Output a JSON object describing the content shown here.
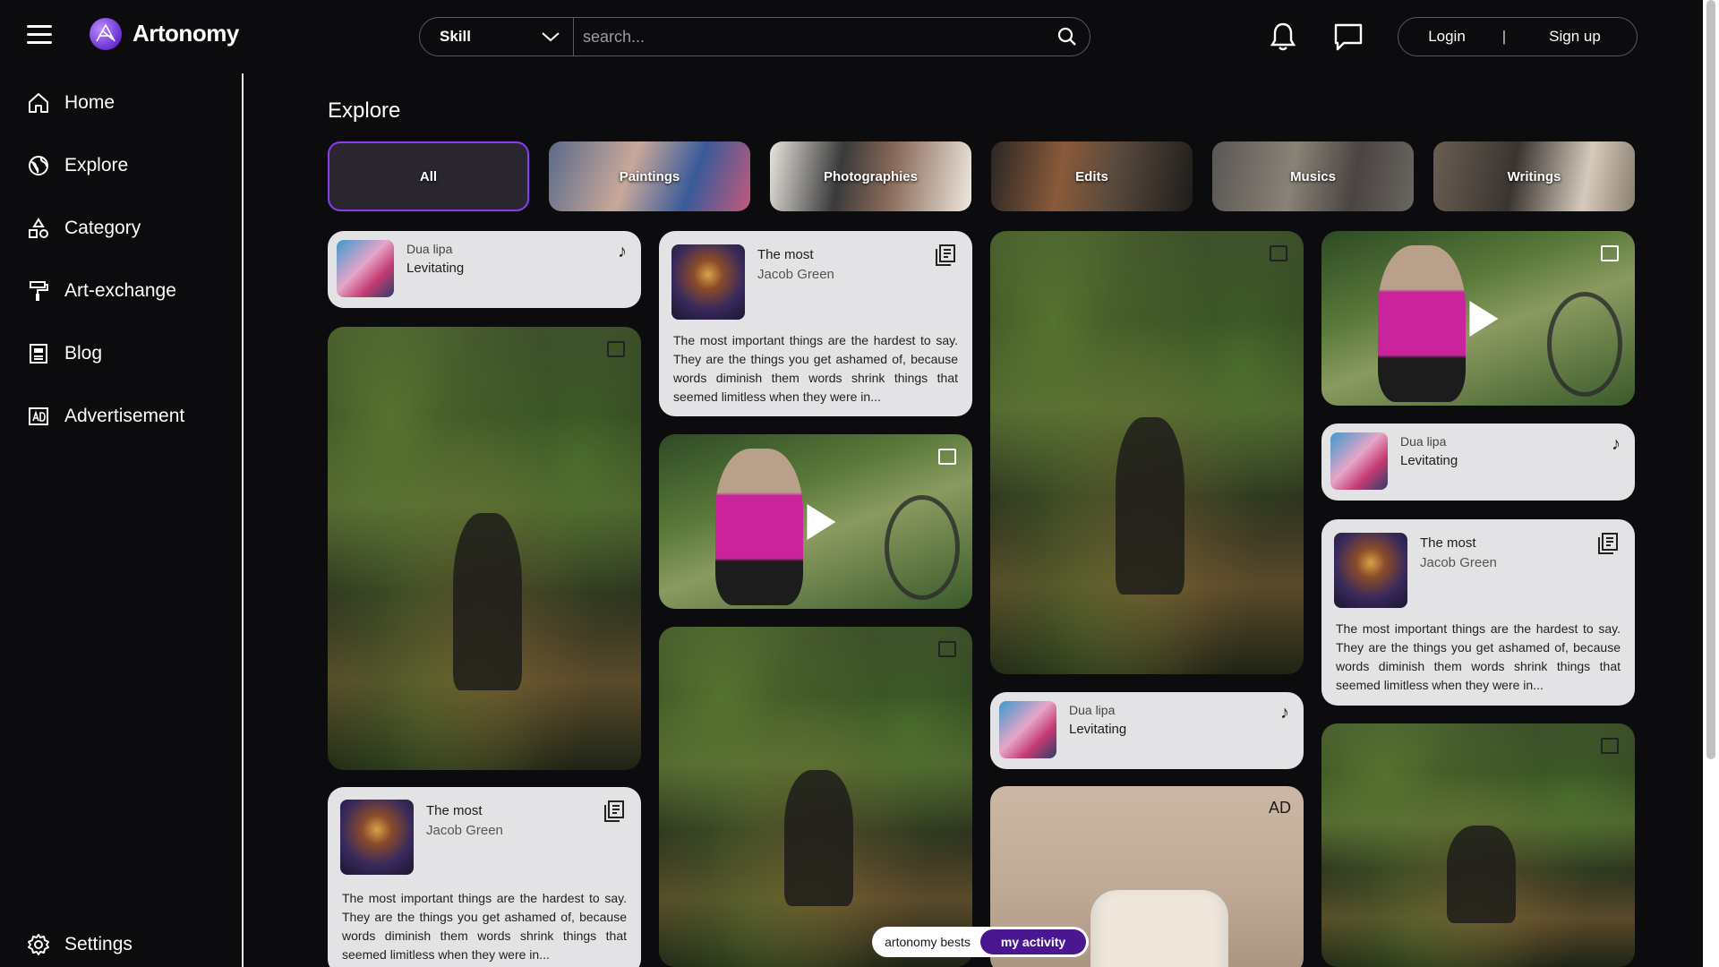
{
  "app": {
    "name": "Artonomy"
  },
  "header": {
    "skill_select": "Skill",
    "search_placeholder": "search...",
    "login": "Login",
    "separator": "|",
    "signup": "Sign up"
  },
  "sidebar": {
    "items": [
      {
        "label": "Home",
        "icon": "home-icon"
      },
      {
        "label": "Explore",
        "icon": "globe-icon"
      },
      {
        "label": "Category",
        "icon": "shapes-icon"
      },
      {
        "label": "Art-exchange",
        "icon": "paint-roller-icon"
      },
      {
        "label": "Blog",
        "icon": "blog-icon"
      },
      {
        "label": "Advertisement",
        "icon": "ad-icon"
      }
    ],
    "settings": "Settings"
  },
  "main": {
    "title": "Explore",
    "categories": [
      "All",
      "Paintings",
      "Photographies",
      "Edits",
      "Musics",
      "Writings"
    ],
    "music": {
      "artist": "Dua lipa",
      "song": "Levitating"
    },
    "text": {
      "title": "The most",
      "author": "Jacob Green",
      "body": "The most important things are the hardest to say. They are the things you get ashamed of, because words diminish them words shrink things that seemed limitless when they were in..."
    },
    "ad_label": "AD",
    "toggle": {
      "left": "artonomy bests",
      "right": "my activity"
    }
  },
  "colors": {
    "accent": "#8a3df0",
    "toggle_active": "#4a1790",
    "card_bg": "#e3e3e5",
    "page_bg": "#0c0c0e"
  }
}
